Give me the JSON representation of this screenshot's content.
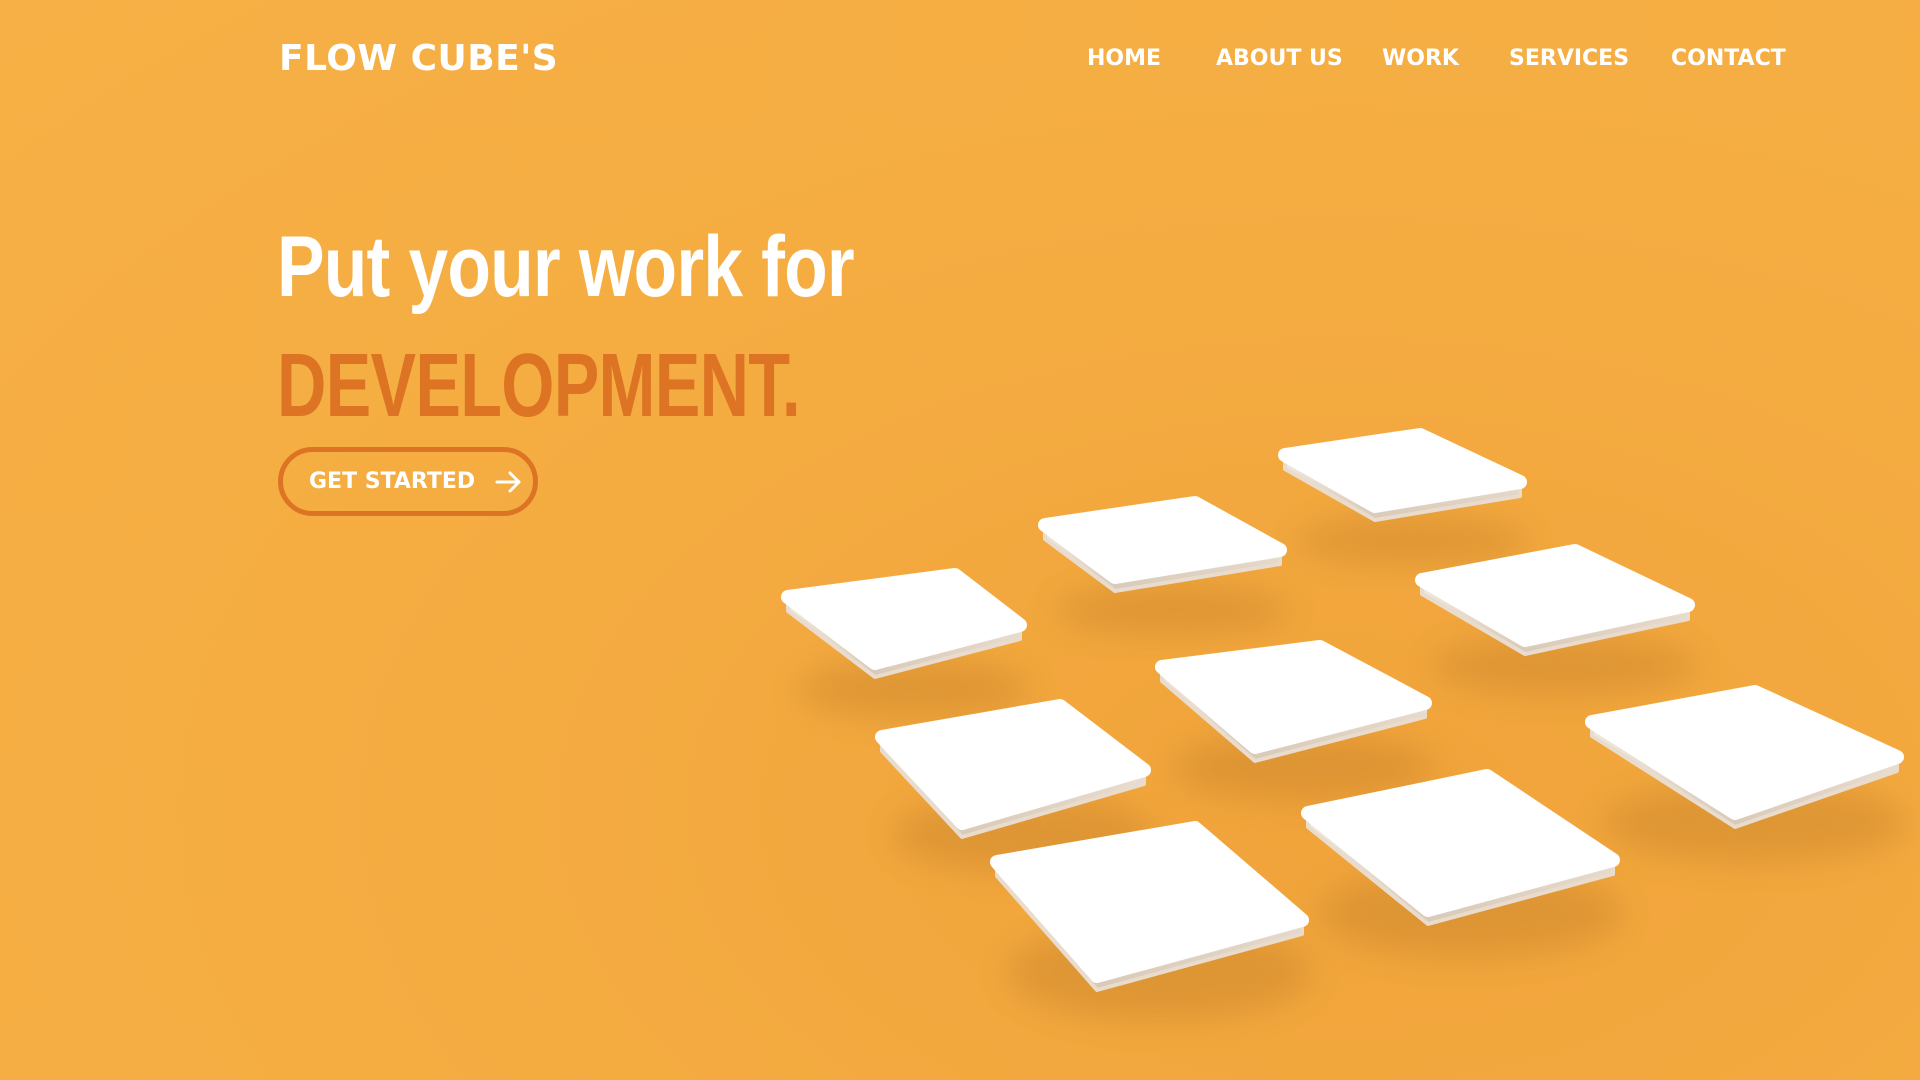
{
  "brand": {
    "logo_text": "FLOW CUBE'S"
  },
  "nav": {
    "items": [
      {
        "label": "HOME"
      },
      {
        "label": "ABOUT US"
      },
      {
        "label": "WORK"
      },
      {
        "label": "SERVICES"
      },
      {
        "label": "CONTACT"
      }
    ]
  },
  "hero": {
    "headline": "Put your work for",
    "headline_accent": "DEVELOPMENT.",
    "cta_label": "GET STARTED",
    "cta_icon": "arrow-right-icon"
  },
  "colors": {
    "background": "#f5ad42",
    "accent": "#dd7424",
    "text": "#ffffff",
    "tile": "#ffffff"
  }
}
